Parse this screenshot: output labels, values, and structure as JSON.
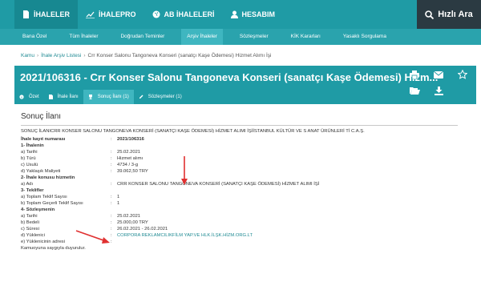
{
  "topnav": {
    "items": [
      {
        "label": "İHALELER",
        "icon": "file-icon",
        "active": true
      },
      {
        "label": "İHALEPRO",
        "icon": "chart-icon",
        "active": false
      },
      {
        "label": "AB İHALELERİ",
        "icon": "globe-icon",
        "active": false
      },
      {
        "label": "HESABIM",
        "icon": "user-icon",
        "active": false
      }
    ],
    "search_label": "Hızlı Ara"
  },
  "subnav": {
    "items": [
      "Bana Özel",
      "Tüm İhaleler",
      "Doğrudan Teminler",
      "Arşiv İhaleler",
      "Sözleşmeler",
      "KİK Kararları",
      "Yasaklı Sorgulama"
    ],
    "active_index": 3
  },
  "breadcrumb": [
    "Kamu",
    "İhale Arşiv Listesi",
    "Crr Konser Salonu Tangoneva Konseri (sanatçı Kaşe Ödemesi) Hizmet Alımı İşi"
  ],
  "header": {
    "title": "2021/106316 - Crr Konser Salonu Tangoneva Konseri (sanatçı Kaşe Ödemesi) Hizm..."
  },
  "tabs": [
    {
      "label": "Özet",
      "icon": "info-icon"
    },
    {
      "label": "İhale İlanı",
      "icon": "doc-icon"
    },
    {
      "label": "Sonuç İlanı (1)",
      "icon": "trophy-icon"
    },
    {
      "label": "Sözleşmeler (1)",
      "icon": "edit-icon"
    }
  ],
  "active_tab_index": 2,
  "content": {
    "heading": "Sonuç İlanı",
    "intro": "SONUÇ İLANICRR KONSER SALONU TANGONEVA KONSERİ (SANATÇI KAŞE ÖDEMESİ) HİZMET ALIMI İŞİİSTANBUL KÜLTÜR VE S ANAT ÜRÜNLERİ Tİ C.A.Ş.",
    "rows": [
      {
        "k": "İhale kayıt numarası",
        "v": "2021/106316",
        "bold": true
      },
      {
        "h": "1- İhalenin"
      },
      {
        "k": "a) Tarihi",
        "v": "25.02.2021"
      },
      {
        "k": "b) Türü",
        "v": "Hizmet alımı"
      },
      {
        "k": "c) Usulü",
        "v": "4734 / 3-g"
      },
      {
        "k": "d) Yaklaşık Maliyeti",
        "v": "39.062,50 TRY"
      },
      {
        "h": "2- İhale konusu hizmetin"
      },
      {
        "k": "a) Adı",
        "v": "CRR KONSER SALONU TANGONEVA KONSERİ (SANATÇI KAŞE ÖDEMESİ) HİZMET ALIMI İŞİ"
      },
      {
        "h": "3- Teklifler"
      },
      {
        "k": "a) Toplam Teklif Sayısı",
        "v": "1"
      },
      {
        "k": "b) Toplam Geçerli Teklif Sayısı",
        "v": "1"
      },
      {
        "h": "4- Sözleşmenin"
      },
      {
        "k": "a) Tarihi",
        "v": "25.02.2021"
      },
      {
        "k": "b) Bedeli",
        "v": "25.000,00 TRY"
      },
      {
        "k": "c) Süresi",
        "v": "26.02.2021 - 26.02.2021"
      },
      {
        "k": "d) Yüklenici",
        "v": "CORPORA REKLAMCILIKFİLM YAP.VE HLK.İLŞK.HİZM.ORG.LT",
        "link": true
      },
      {
        "k": "e) Yüklenicinin adresi",
        "v": ""
      }
    ],
    "footer": "Kamuoyuna saygıyla duyurulur."
  },
  "colors": {
    "primary": "#1f9ba5",
    "dark": "#2b3a42",
    "annotation": "#e03030"
  }
}
